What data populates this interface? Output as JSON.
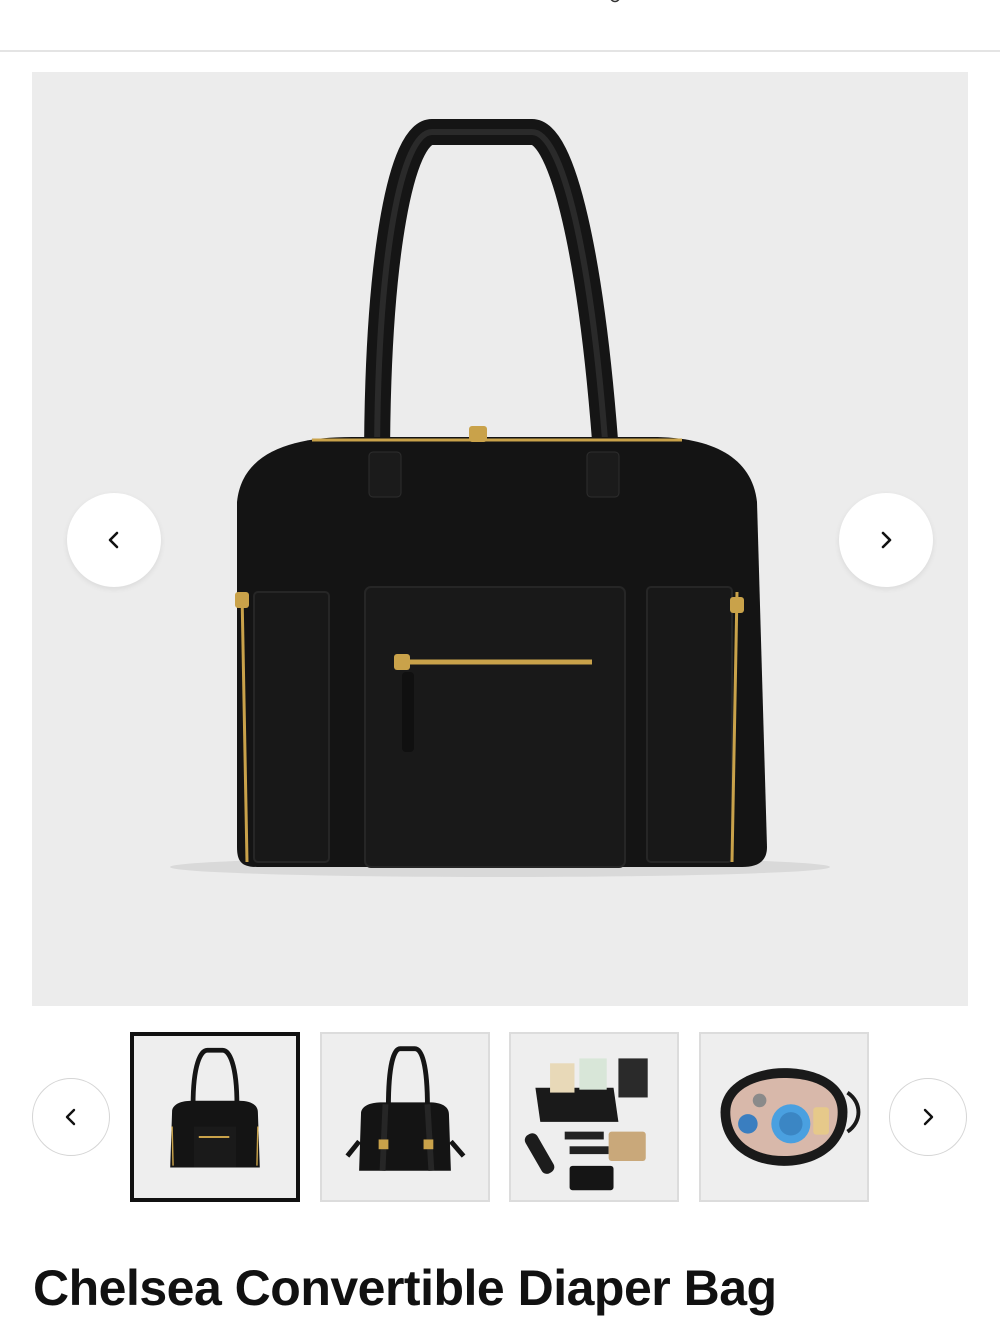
{
  "header": {
    "logo_icon": "brand-script-logo"
  },
  "gallery": {
    "hero_image": "product-image-black-bag-front",
    "prev_icon": "chevron-left-icon",
    "next_icon": "chevron-right-icon",
    "thumbnails": [
      {
        "name": "bag-front-view",
        "active": true
      },
      {
        "name": "bag-back-view",
        "active": false
      },
      {
        "name": "bag-contents-flatlay",
        "active": false
      },
      {
        "name": "bag-interior-top-view",
        "active": false
      }
    ]
  },
  "product": {
    "title": "Chelsea Convertible Diaper Bag"
  },
  "colors": {
    "hero_bg": "#ececec",
    "bag": "#141414",
    "zipper": "#c9a24a"
  }
}
